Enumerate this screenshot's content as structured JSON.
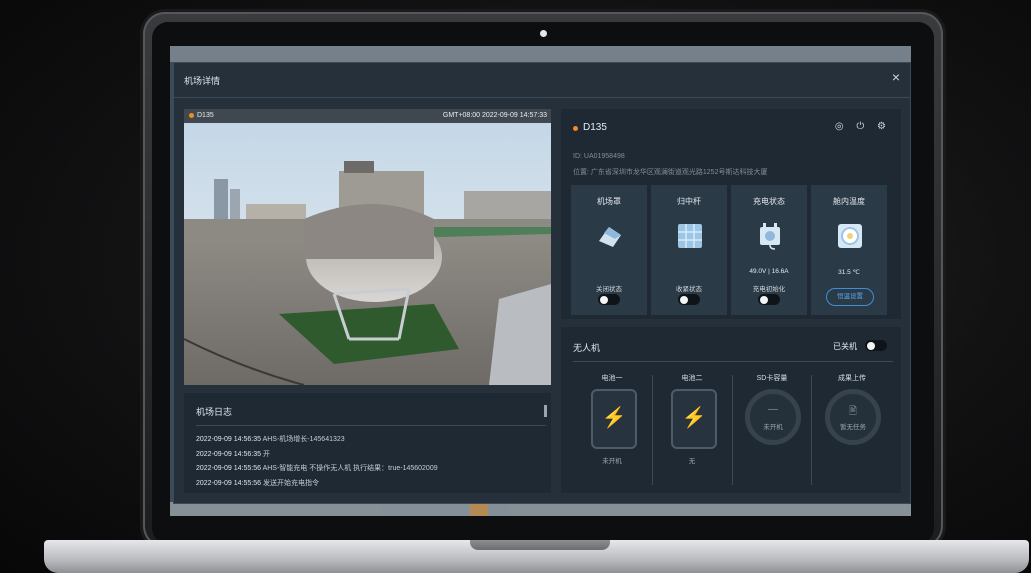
{
  "dialog": {
    "title": "机场详情",
    "close_icon": "×"
  },
  "video": {
    "device": "D135",
    "timestamp": "GMT+08:00 2022-09-09 14:57:33"
  },
  "log": {
    "title": "机场日志",
    "entries": [
      {
        "time": "2022-09-09 14:56:35",
        "text": "AHS-机场增长-145641323"
      },
      {
        "time": "2022-09-09 14:56:35",
        "text": "开"
      },
      {
        "time": "2022-09-09 14:55:56",
        "text": "AHS-智能充电 不操作无人机 执行结果：true-145602009"
      },
      {
        "time": "2022-09-09 14:55:56",
        "text": "发送开始充电指令"
      }
    ]
  },
  "device": {
    "name": "D135",
    "id": "ID: UA01958498",
    "location": "位置: 广东省深圳市龙华区观澜街道观光路1252号斯达科技大厦",
    "header_icons": "◎ ⏻ ⚙",
    "accent": "#f08c22"
  },
  "cards": [
    {
      "title": "机场罩",
      "value": "",
      "state": "关闭状态",
      "icon": "hangar-cover-icon"
    },
    {
      "title": "归中杆",
      "value": "",
      "state": "收紧状态",
      "icon": "centering-rod-icon"
    },
    {
      "title": "充电状态",
      "value": "49.0V | 16.6A",
      "state": "充电初始化",
      "icon": "charging-icon"
    },
    {
      "title": "舱内温度",
      "value": "31.5 ℃",
      "button": "恒温设置",
      "icon": "thermometer-icon"
    }
  ],
  "drone": {
    "title": "无人机",
    "status": "已关机",
    "columns": [
      {
        "title": "电池一",
        "foot": "未开机"
      },
      {
        "title": "电池二",
        "foot": "无"
      },
      {
        "title": "SD卡容量",
        "ring_text": "未开机",
        "ring_icon": "—"
      },
      {
        "title": "成果上传",
        "ring_text": "暂无任务",
        "ring_icon": "🖹"
      }
    ]
  }
}
